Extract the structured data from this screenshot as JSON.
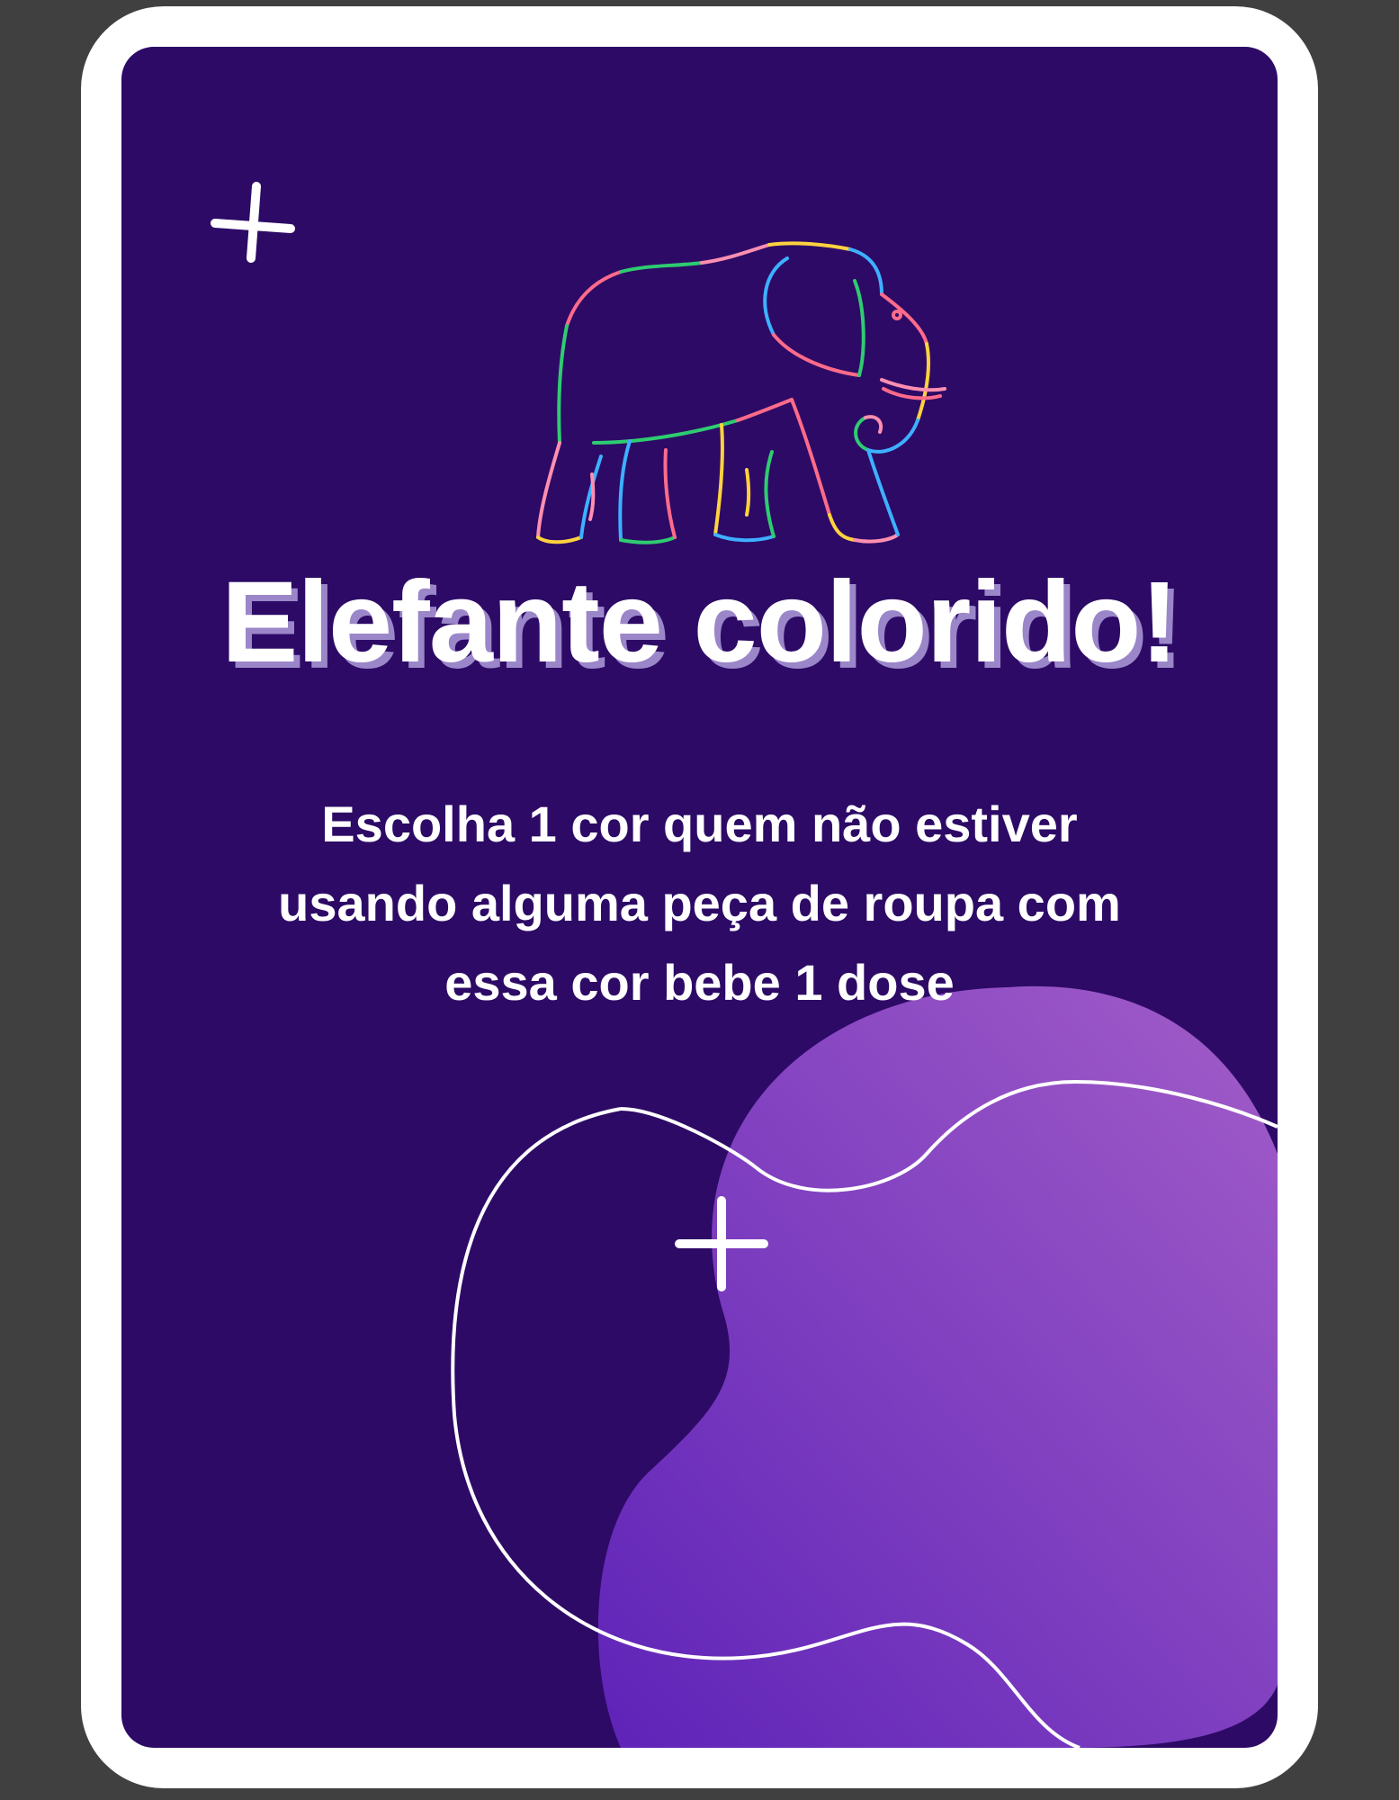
{
  "card": {
    "title": "Elefante colorido!",
    "instruction": "Escolha 1 cor quem não estiver usando alguma peça de roupa com essa cor bebe 1 dose"
  },
  "icons": {
    "illustration": "elephant-icon",
    "decorations": [
      "plus-sparkle-icon",
      "plus-sparkle-icon"
    ]
  },
  "colors": {
    "page_background": "#404040",
    "card_border": "#ffffff",
    "card_background": "#2d0a66",
    "blob_gradient_start": "#5e23b8",
    "blob_gradient_end": "#a25dc8",
    "title_shadow": "#9a86c8",
    "elephant_outline": [
      "#ff6b8a",
      "#ffd23f",
      "#3db0ff",
      "#2ecc71",
      "#ff8fb1"
    ]
  }
}
